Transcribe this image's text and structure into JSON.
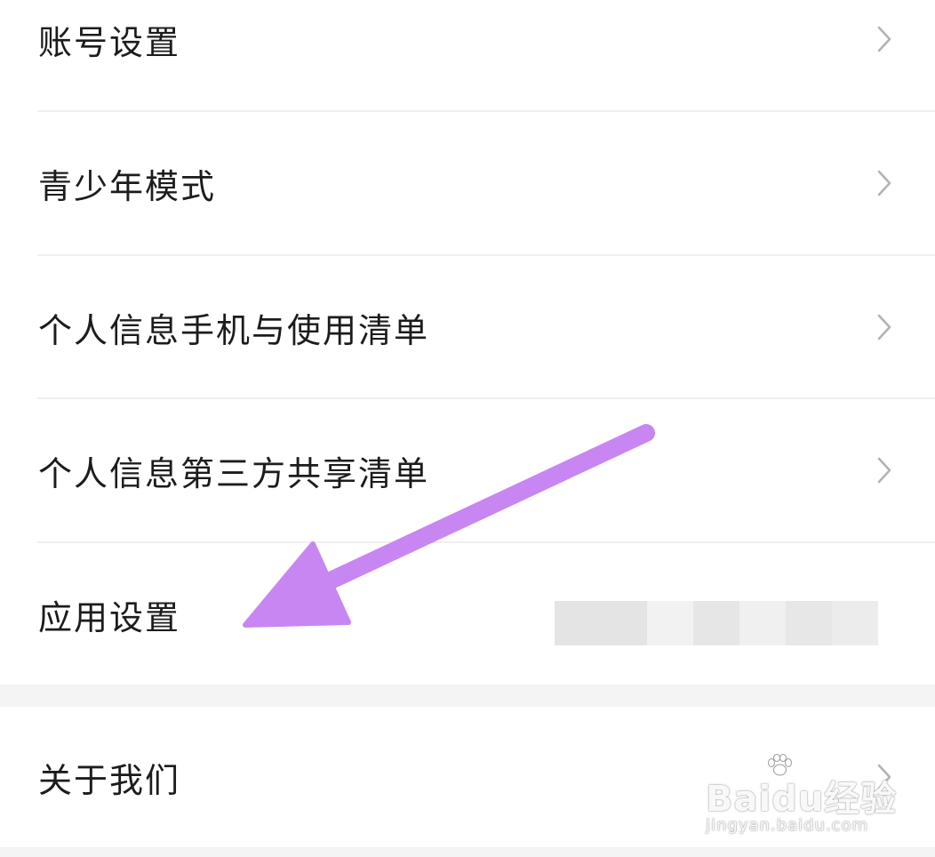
{
  "settings": {
    "items": [
      {
        "label": "账号设置"
      },
      {
        "label": "青少年模式"
      },
      {
        "label": "个人信息手机与使用清单"
      },
      {
        "label": "个人信息第三方共享清单"
      },
      {
        "label": "应用设置"
      }
    ],
    "about": {
      "label": "关于我们"
    }
  },
  "annotation": {
    "arrow_color": "#c886f2",
    "icon": "arrow-pointer-icon"
  },
  "watermark": {
    "brand": "Baidu经验",
    "url": "jingyan.baidu.com"
  },
  "colors": {
    "background": "#f4f4f4",
    "card": "#ffffff",
    "text": "#1c1c1c",
    "chevron": "#b3b3b3"
  }
}
